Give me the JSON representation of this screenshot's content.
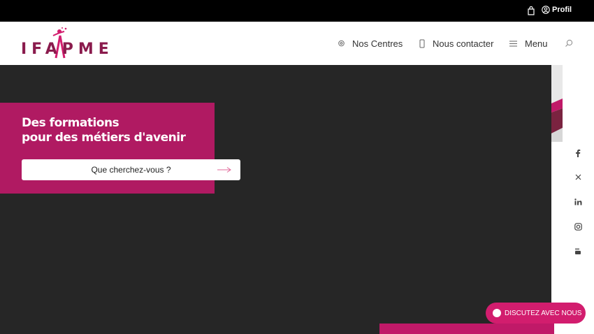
{
  "topbar": {
    "cart_icon": "shopping-bag-icon",
    "profile_label": "Profil"
  },
  "logo": {
    "text": "IFAPME"
  },
  "nav": {
    "centres": {
      "label": "Nos Centres",
      "icon": "location-pin-icon"
    },
    "contact": {
      "label": "Nous contacter",
      "icon": "phone-icon"
    },
    "menu": {
      "label": "Menu",
      "icon": "hamburger-icon"
    },
    "search_icon": "search-icon"
  },
  "hero": {
    "title_line1": "Des formations",
    "title_line2": "pour des métiers d'avenir",
    "search_label": "Que cherchez-vous ?"
  },
  "social": [
    "facebook-icon",
    "x-icon",
    "linkedin-icon",
    "instagram-icon",
    "youtube-icon"
  ],
  "chat": {
    "label": "DISCUTEZ AVEC NOUS"
  },
  "colors": {
    "brand": "#b01a62",
    "accent": "#d21d6e",
    "logo": "#8a1b4d",
    "hero_bg": "#262626"
  }
}
